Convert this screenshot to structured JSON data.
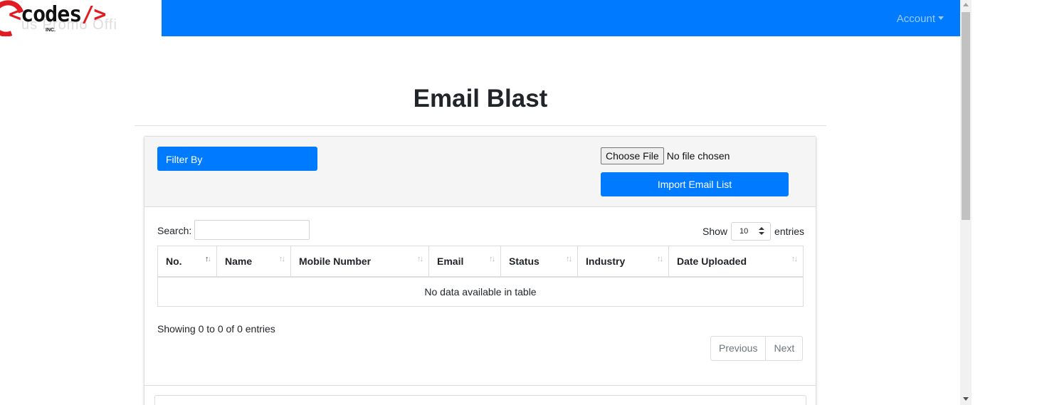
{
  "brand": {
    "logo_text": "codes",
    "logo_open": "<",
    "logo_close": "/>",
    "logo_sub": "INC.",
    "logo_ghost": "us Promo Offi"
  },
  "navbar": {
    "account_label": "Account",
    "color": "#007bff"
  },
  "page": {
    "title": "Email Blast"
  },
  "toolbar": {
    "filter_label": "Filter By",
    "choose_file_label": "Choose File",
    "file_status": "No file chosen",
    "import_label": "Import Email List"
  },
  "table_controls": {
    "search_label": "Search:",
    "show_label": "Show",
    "entries_value": "10",
    "entries_label": "entries"
  },
  "table": {
    "columns": [
      "No.",
      "Name",
      "Mobile Number",
      "Email",
      "Status",
      "Industry",
      "Date Uploaded"
    ],
    "empty_message": "No data available in table",
    "sorted_column": "No."
  },
  "footer": {
    "info": "Showing 0 to 0 of 0 entries",
    "previous_label": "Previous",
    "next_label": "Next"
  }
}
